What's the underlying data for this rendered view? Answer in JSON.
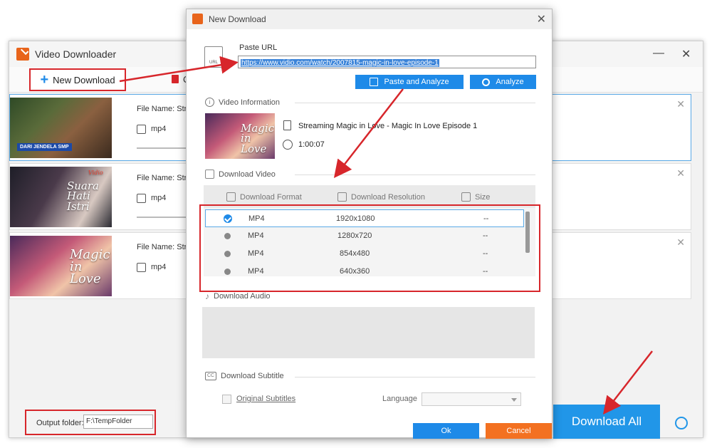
{
  "app": {
    "title": "Video Downloader",
    "minimize": "—",
    "close": "✕"
  },
  "toolbar": {
    "new_download": "New Download",
    "clear": "C"
  },
  "downloads": [
    {
      "file_name": "File Name: Stre",
      "format": "mp4",
      "thumb_tag": "DARI JENDELA SMP"
    },
    {
      "file_name": "File Name: Stre",
      "format": "mp4",
      "thumb_text": "Suara Hati Istri",
      "thumb_brand": "Vidio"
    },
    {
      "file_name": "File Name: Stre",
      "format": "mp4",
      "thumb_text": "Magic in Love"
    }
  ],
  "bottom": {
    "output_label": "Output folder:",
    "output_value": "F:\\TempFolder",
    "download_all": "Download All"
  },
  "dialog": {
    "title": "New Download",
    "close": "✕",
    "paste_url_label": "Paste URL",
    "url_value": "https://www.vidio.com/watch/2007815-magic-in-love-episode-1",
    "paste_analyze": "Paste and Analyze",
    "analyze": "Analyze",
    "video_info_title": "Video Information",
    "video_name": "Streaming Magic in Love - Magic In Love Episode 1",
    "video_duration": "1:00:07",
    "download_video_title": "Download Video",
    "col_format": "Download Format",
    "col_resolution": "Download Resolution",
    "col_size": "Size",
    "formats": [
      {
        "format": "MP4",
        "resolution": "1920x1080",
        "size": "--"
      },
      {
        "format": "MP4",
        "resolution": "1280x720",
        "size": "--"
      },
      {
        "format": "MP4",
        "resolution": "854x480",
        "size": "--"
      },
      {
        "format": "MP4",
        "resolution": "640x360",
        "size": "--"
      }
    ],
    "download_audio_title": "Download Audio",
    "download_subtitle_title": "Download Subtitle",
    "original_subtitles": "Original Subtitles",
    "language_label": "Language",
    "ok": "Ok",
    "cancel": "Cancel"
  },
  "colors": {
    "accent": "#1e8ae8",
    "annotation_red": "#d7262b",
    "cancel_orange": "#f37121",
    "brand_orange": "#e8641b"
  }
}
